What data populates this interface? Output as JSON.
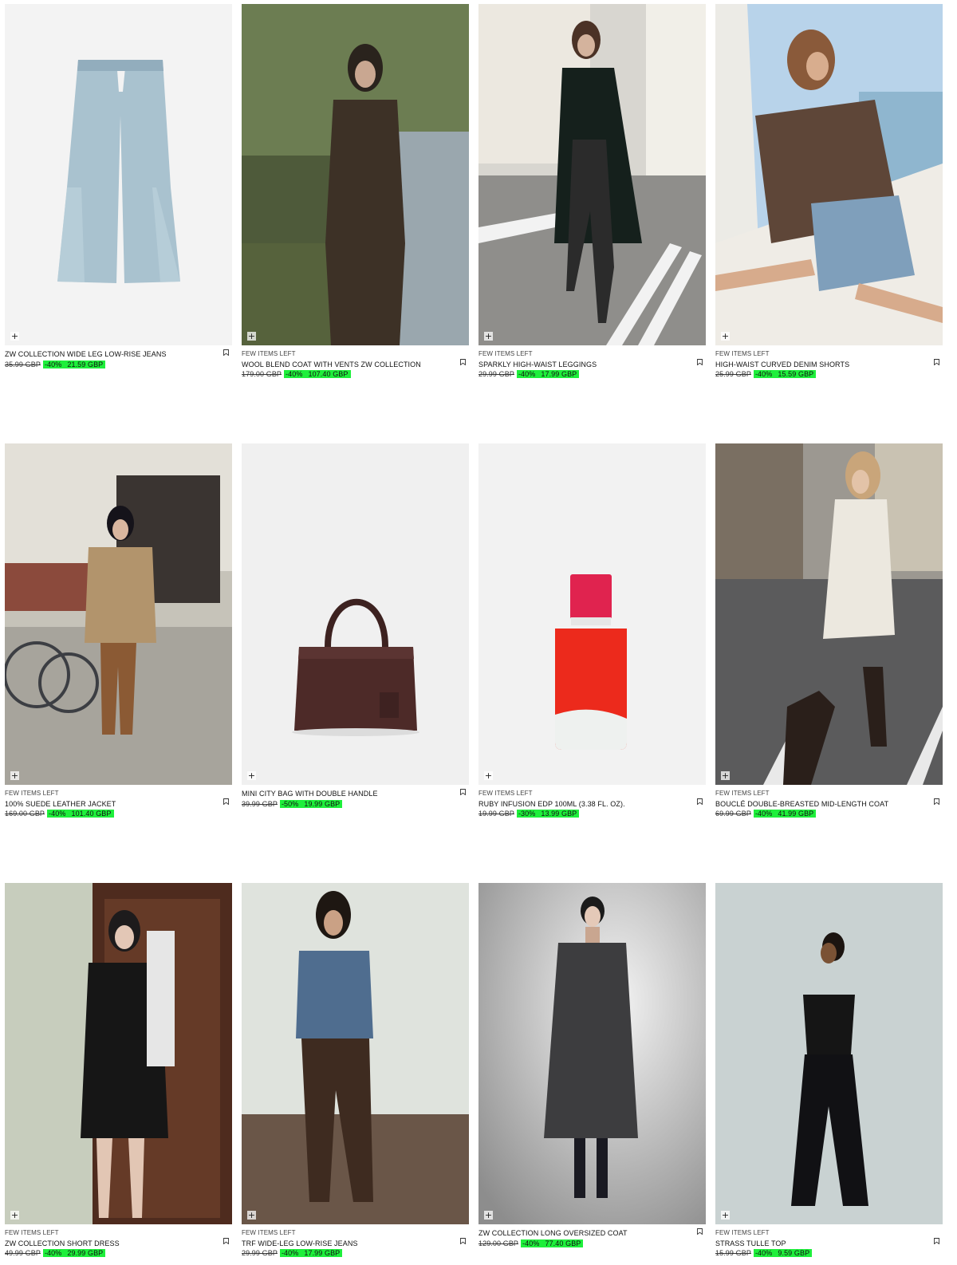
{
  "icons": {
    "add": "+",
    "bookmark": "bookmark-icon"
  },
  "colors": {
    "discount_highlight": "#1eef3b"
  },
  "products": [
    {
      "avail": "",
      "name": "ZW COLLECTION WIDE LEG LOW-RISE JEANS",
      "old_price": "35.99 GBP",
      "discount": "-40%",
      "new_price": "21.59 GBP"
    },
    {
      "avail": "FEW ITEMS LEFT",
      "name": "WOOL BLEND COAT WITH VENTS ZW COLLECTION",
      "old_price": "179.00 GBP",
      "discount": "-40%",
      "new_price": "107.40 GBP"
    },
    {
      "avail": "FEW ITEMS LEFT",
      "name": "SPARKLY HIGH-WAIST LEGGINGS",
      "old_price": "29.99 GBP",
      "discount": "-40%",
      "new_price": "17.99 GBP"
    },
    {
      "avail": "FEW ITEMS LEFT",
      "name": "HIGH-WAIST CURVED DENIM SHORTS",
      "old_price": "25.99 GBP",
      "discount": "-40%",
      "new_price": "15.59 GBP"
    },
    {
      "avail": "FEW ITEMS LEFT",
      "name": "100% SUEDE LEATHER JACKET",
      "old_price": "169.00 GBP",
      "discount": "-40%",
      "new_price": "101.40 GBP"
    },
    {
      "avail": "",
      "name": "MINI CITY BAG WITH DOUBLE HANDLE",
      "old_price": "39.99 GBP",
      "discount": "-50%",
      "new_price": "19.99 GBP"
    },
    {
      "avail": "FEW ITEMS LEFT",
      "name": "RUBY INFUSION EDP 100ML (3.38 FL. OZ).",
      "old_price": "19.99 GBP",
      "discount": "-30%",
      "new_price": "13.99 GBP"
    },
    {
      "avail": "FEW ITEMS LEFT",
      "name": "BOUCLÉ DOUBLE-BREASTED MID-LENGTH COAT",
      "old_price": "69.99 GBP",
      "discount": "-40%",
      "new_price": "41.99 GBP"
    },
    {
      "avail": "FEW ITEMS LEFT",
      "name": "ZW COLLECTION SHORT DRESS",
      "old_price": "49.99 GBP",
      "discount": "-40%",
      "new_price": "29.99 GBP"
    },
    {
      "avail": "FEW ITEMS LEFT",
      "name": "TRF WIDE-LEG LOW-RISE JEANS",
      "old_price": "29.99 GBP",
      "discount": "-40%",
      "new_price": "17.99 GBP"
    },
    {
      "avail": "",
      "name": "ZW COLLECTION LONG OVERSIZED COAT",
      "old_price": "129.00 GBP",
      "discount": "-40%",
      "new_price": "77.40 GBP"
    },
    {
      "avail": "FEW ITEMS LEFT",
      "name": "STRASS TULLE TOP",
      "old_price": "15.99 GBP",
      "discount": "-40%",
      "new_price": "9.59 GBP"
    }
  ]
}
